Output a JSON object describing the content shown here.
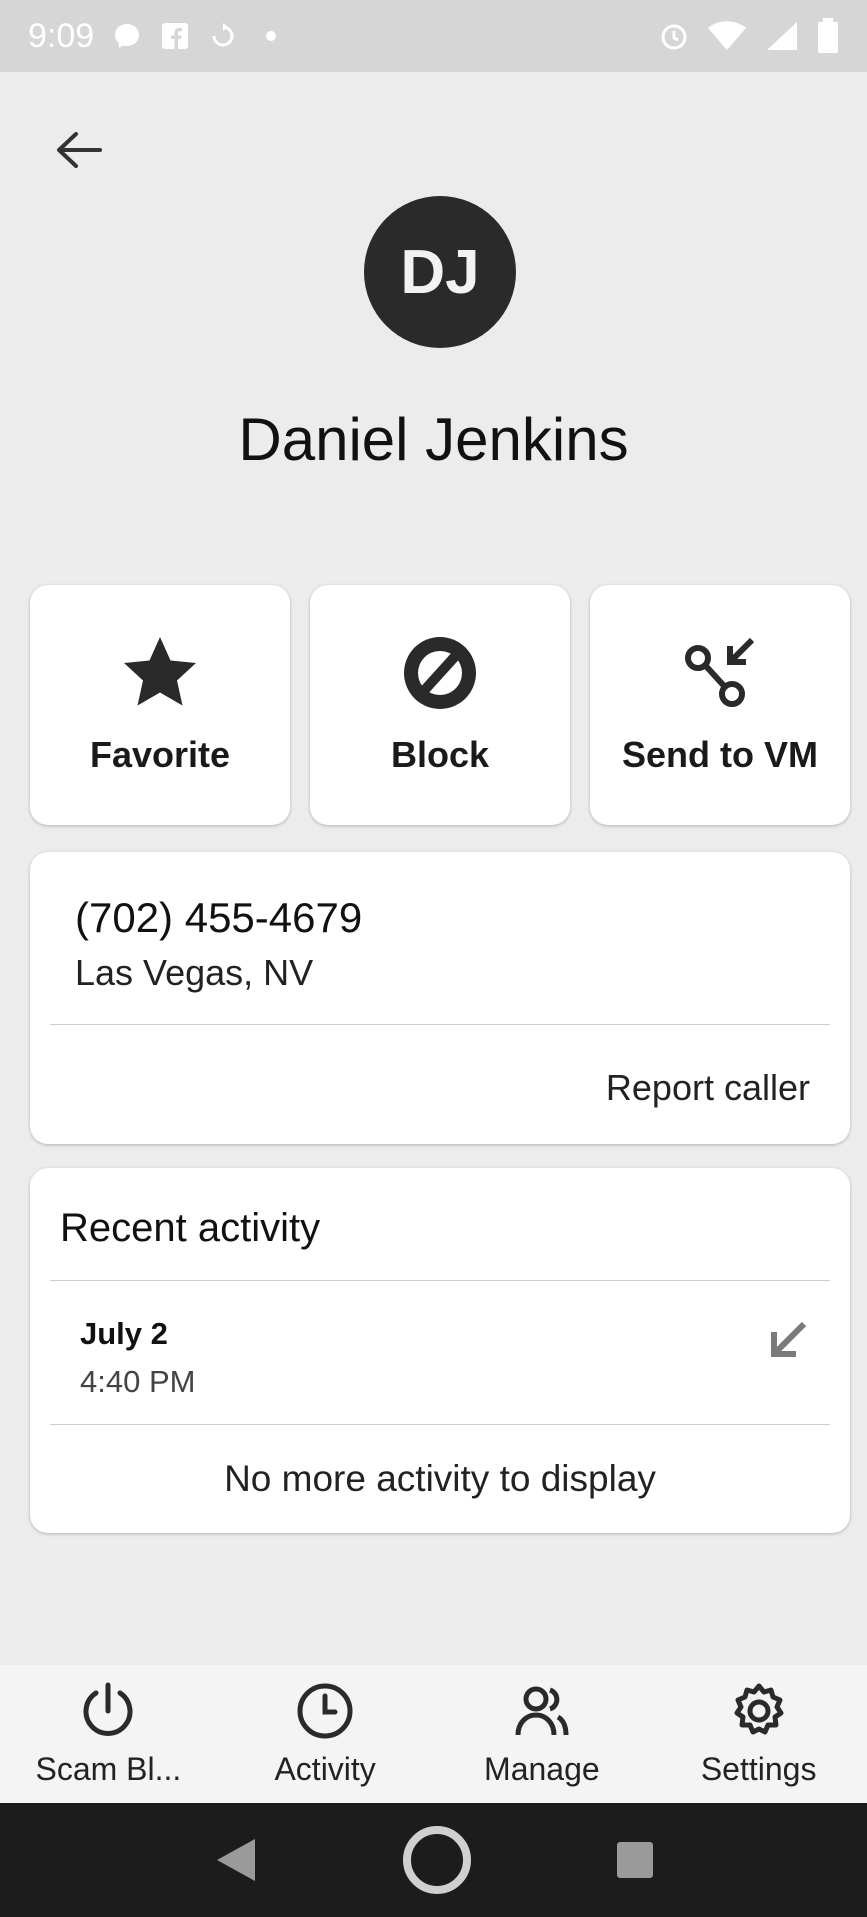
{
  "status_bar": {
    "time": "9:09"
  },
  "contact": {
    "initials": "DJ",
    "name": "Daniel Jenkins"
  },
  "actions": [
    {
      "label": "Favorite",
      "icon": "star-icon"
    },
    {
      "label": "Block",
      "icon": "block-icon"
    },
    {
      "label": "Send to VM",
      "icon": "voicemail-forward-icon"
    }
  ],
  "phone_card": {
    "number": "(702) 455-4679",
    "location": "Las Vegas, NV",
    "report_label": "Report caller"
  },
  "activity": {
    "title": "Recent activity",
    "items": [
      {
        "date": "July 2",
        "time": "4:40 PM",
        "icon": "incoming-call-arrow-icon"
      }
    ],
    "empty_text": "No more activity to display"
  },
  "bottom_nav": [
    {
      "label": "Scam Bl...",
      "icon": "power-icon"
    },
    {
      "label": "Activity",
      "icon": "clock-icon"
    },
    {
      "label": "Manage",
      "icon": "people-icon"
    },
    {
      "label": "Settings",
      "icon": "gear-icon"
    }
  ],
  "colors": {
    "avatar_bg": "#2a2a2a",
    "card_bg": "#ffffff",
    "page_bg": "#ececec"
  }
}
